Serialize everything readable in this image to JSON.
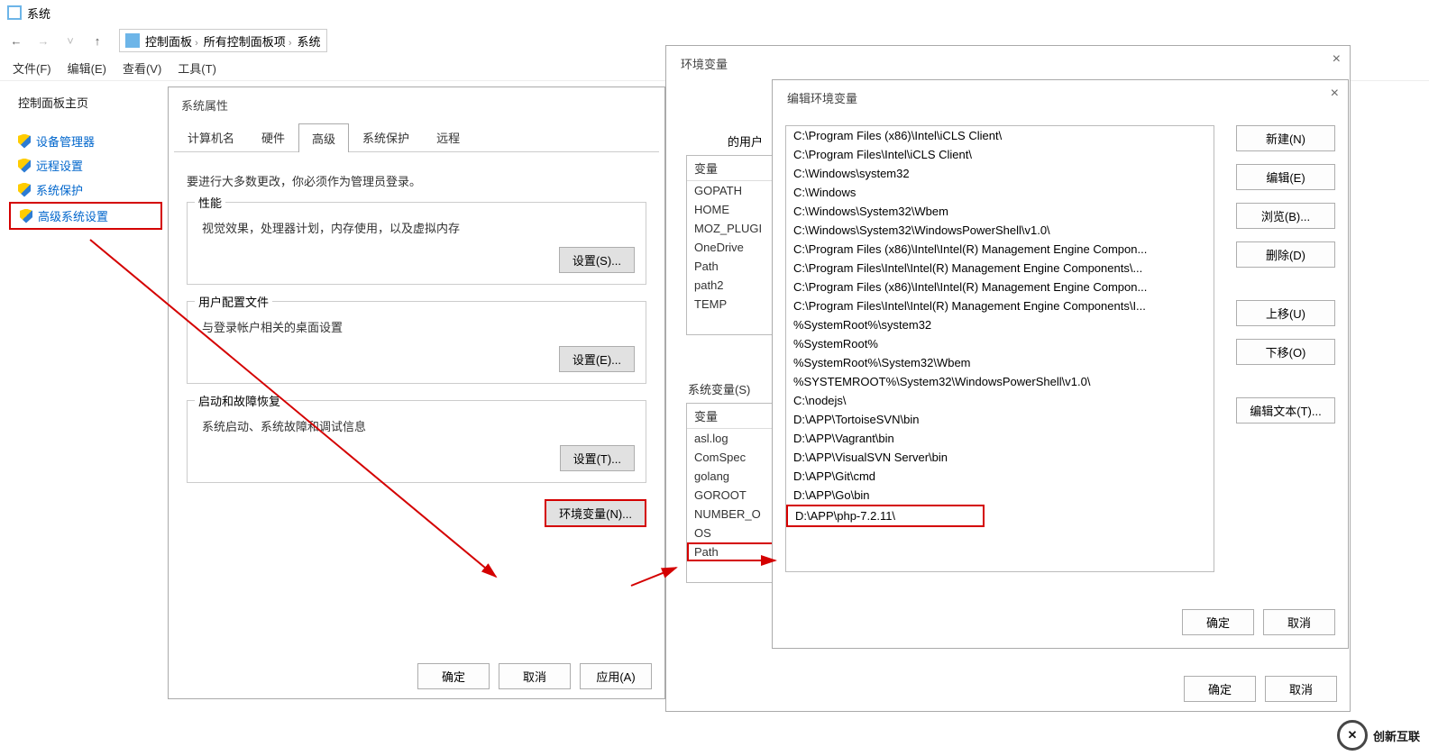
{
  "window": {
    "title": "系统",
    "breadcrumbs": [
      "控制面板",
      "所有控制面板项",
      "系统"
    ],
    "menus": [
      "文件(F)",
      "编辑(E)",
      "查看(V)",
      "工具(T)"
    ]
  },
  "sidebar": {
    "header": "控制面板主页",
    "links": [
      "设备管理器",
      "远程设置",
      "系统保护",
      "高级系统设置"
    ]
  },
  "sysprop": {
    "title": "系统属性",
    "tabs": [
      "计算机名",
      "硬件",
      "高级",
      "系统保护",
      "远程"
    ],
    "note": "要进行大多数更改，你必须作为管理员登录。",
    "perf": {
      "legend": "性能",
      "desc": "视觉效果，处理器计划，内存使用，以及虚拟内存",
      "btn": "设置(S)..."
    },
    "profile": {
      "legend": "用户配置文件",
      "desc": "与登录帐户相关的桌面设置",
      "btn": "设置(E)..."
    },
    "startup": {
      "legend": "启动和故障恢复",
      "desc": "系统启动、系统故障和调试信息",
      "btn": "设置(T)..."
    },
    "envbtn": "环境变量(N)...",
    "ok": "确定",
    "cancel": "取消",
    "apply": "应用(A)"
  },
  "env": {
    "title": "环境变量",
    "user_section": "的用户",
    "var_col": "变量",
    "user_vars": [
      "GOPATH",
      "HOME",
      "MOZ_PLUGI",
      "OneDrive",
      "Path",
      "path2",
      "TEMP"
    ],
    "sys_section": "系统变量(S)",
    "sys_vars": [
      "asl.log",
      "ComSpec",
      "golang",
      "GOROOT",
      "NUMBER_O",
      "OS",
      "Path"
    ],
    "ok": "确定",
    "cancel": "取消"
  },
  "edit": {
    "title": "编辑环境变量",
    "paths": [
      "C:\\Program Files (x86)\\Intel\\iCLS Client\\",
      "C:\\Program Files\\Intel\\iCLS Client\\",
      "C:\\Windows\\system32",
      "C:\\Windows",
      "C:\\Windows\\System32\\Wbem",
      "C:\\Windows\\System32\\WindowsPowerShell\\v1.0\\",
      "C:\\Program Files (x86)\\Intel\\Intel(R) Management Engine Compon...",
      "C:\\Program Files\\Intel\\Intel(R) Management Engine Components\\...",
      "C:\\Program Files (x86)\\Intel\\Intel(R) Management Engine Compon...",
      "C:\\Program Files\\Intel\\Intel(R) Management Engine Components\\I...",
      "%SystemRoot%\\system32",
      "%SystemRoot%",
      "%SystemRoot%\\System32\\Wbem",
      "%SYSTEMROOT%\\System32\\WindowsPowerShell\\v1.0\\",
      "C:\\nodejs\\",
      "D:\\APP\\TortoiseSVN\\bin",
      "D:\\APP\\Vagrant\\bin",
      "D:\\APP\\VisualSVN Server\\bin",
      "D:\\APP\\Git\\cmd",
      "D:\\APP\\Go\\bin",
      "D:\\APP\\php-7.2.11\\"
    ],
    "btns": {
      "new": "新建(N)",
      "edit": "编辑(E)",
      "browse": "浏览(B)...",
      "delete": "删除(D)",
      "up": "上移(U)",
      "down": "下移(O)",
      "edittext": "编辑文本(T)..."
    },
    "ok": "确定",
    "cancel": "取消"
  },
  "watermark": "创新互联"
}
